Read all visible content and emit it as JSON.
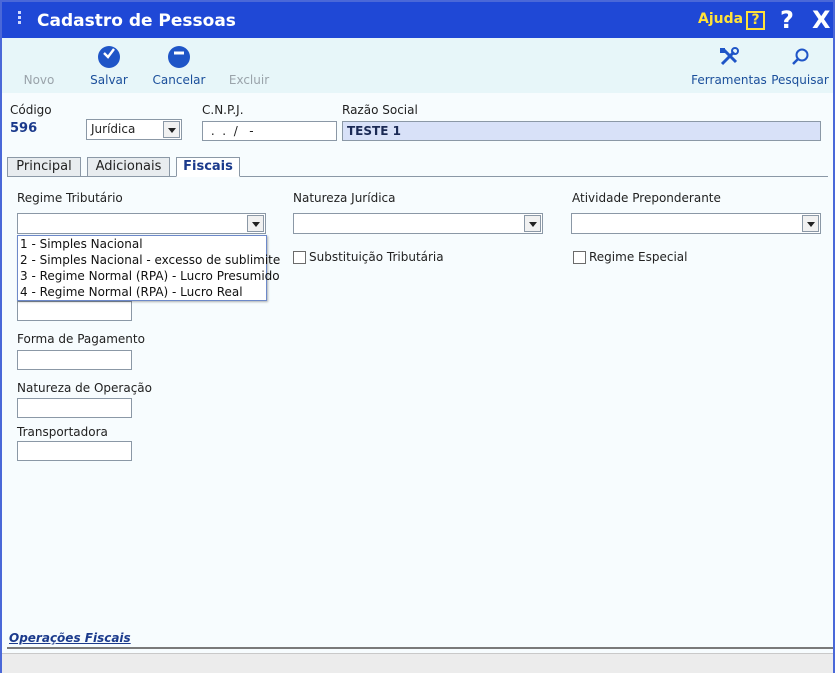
{
  "window": {
    "title": "Cadastro de Pessoas",
    "help_label": "Ajuda",
    "help_icon": "?",
    "question_icon": "?",
    "close_icon": "X"
  },
  "toolbar": {
    "novo": "Novo",
    "salvar": "Salvar",
    "cancelar": "Cancelar",
    "excluir": "Excluir",
    "ferramentas": "Ferramentas",
    "pesquisar": "Pesquisar"
  },
  "header": {
    "codigo_label": "Código",
    "codigo_value": "596",
    "tipo_value": "Jurídica",
    "cnpj_label": "C.N.P.J.",
    "cnpj_value": " .  .  /   -",
    "razao_label": "Razão Social",
    "razao_value": "TESTE 1"
  },
  "tabs": [
    "Principal",
    "Adicionais",
    "Fiscais"
  ],
  "fiscais": {
    "regime_label": "Regime Tributário",
    "natureza_juridica_label": "Natureza Jurídica",
    "atividade_label": "Atividade Preponderante",
    "substituicao_label": "Substituição Tributária",
    "regime_especial_label": "Regime Especial",
    "forma_pagamento_label": "Forma de Pagamento",
    "natureza_operacao_label": "Natureza de Operação",
    "transportadora_label": "Transportadora",
    "regime_options": [
      "1 - Simples Nacional",
      "2 - Simples Nacional - excesso de sublimite",
      "3 - Regime Normal (RPA) - Lucro Presumido",
      "4 - Regime Normal (RPA) - Lucro Real"
    ]
  },
  "footer": {
    "operacoes_link": "Operações Fiscais"
  },
  "colors": {
    "titlebar": "#1f48d6",
    "accent": "#1b3a8c",
    "help": "#ffe23a"
  }
}
